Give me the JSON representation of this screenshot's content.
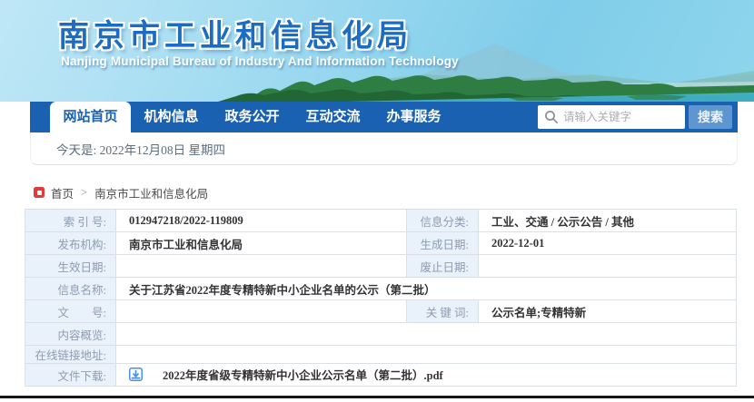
{
  "header": {
    "title": "南京市工业和信息化局",
    "subtitle": "Nanjing Municipal Bureau of Industry And Information Technology"
  },
  "nav": {
    "tabs": [
      {
        "label": "网站首页",
        "active": true
      },
      {
        "label": "机构信息",
        "active": false
      },
      {
        "label": "政务公开",
        "active": false
      },
      {
        "label": "互动交流",
        "active": false
      },
      {
        "label": "办事服务",
        "active": false
      }
    ],
    "search": {
      "placeholder": "请输入关键字",
      "button": "搜索"
    }
  },
  "datebar": {
    "text": "今天是: 2022年12月08日  星期四"
  },
  "breadcrumb": {
    "home": "首页",
    "separator": ">",
    "current": "南京市工业和信息化局"
  },
  "table": {
    "rows": [
      {
        "cells": [
          {
            "t": "索 引 号:"
          },
          {
            "t": "012947218/2022-119809"
          },
          {
            "t": "信息分类:"
          },
          {
            "t": "工业、交通 / 公示公告 / 其他"
          }
        ]
      },
      {
        "cells": [
          {
            "t": "发布机构:"
          },
          {
            "t": "南京市工业和信息化局"
          },
          {
            "t": "生成日期:"
          },
          {
            "t": "2022-12-01"
          }
        ]
      },
      {
        "cells": [
          {
            "t": "生效日期:"
          },
          {
            "t": ""
          },
          {
            "t": "废止日期:"
          },
          {
            "t": ""
          }
        ]
      },
      {
        "cells": [
          {
            "t": "信息名称:"
          },
          {
            "t": "关于江苏省2022年度专精特新中小企业名单的公示（第二批）"
          }
        ]
      },
      {
        "cells": [
          {
            "t": "文　　号:"
          },
          {
            "t": ""
          },
          {
            "t": "关 键 词:"
          },
          {
            "t": "公示名单;专精特新"
          }
        ]
      },
      {
        "cells": [
          {
            "t": "内容概览:"
          },
          {
            "t": ""
          }
        ]
      },
      {
        "cells": [
          {
            "t": "在线链接地址:"
          },
          {
            "t": ""
          }
        ]
      },
      {
        "cells": [
          {
            "t": "文件下载:"
          },
          {
            "t": "2022年度省级专精特新中小企业公示名单（第二批）.pdf"
          }
        ]
      }
    ]
  },
  "icons": {
    "search": "search-icon",
    "home": "home-icon",
    "download": "download-icon"
  },
  "colors": {
    "nav_blue": "#1b61b2",
    "search_button_blue": "#5e96d2",
    "label_cell_bg": "#e9f1fa",
    "breadcrumb_icon_red": "#e23b3b",
    "download_icon_blue": "#4a90e2",
    "title_blue": "#1a6cc4"
  }
}
